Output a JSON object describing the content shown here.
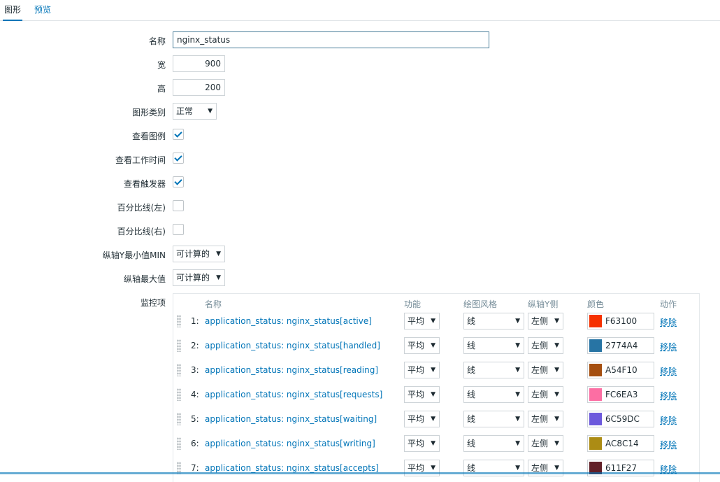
{
  "tabs": [
    {
      "label": "图形",
      "active": true
    },
    {
      "label": "预览",
      "active": false
    }
  ],
  "form": {
    "name_label": "名称",
    "name_value": "nginx_status",
    "width_label": "宽",
    "width_value": "900",
    "height_label": "高",
    "height_value": "200",
    "graph_type_label": "图形类别",
    "graph_type_value": "正常",
    "show_legend_label": "查看图例",
    "show_legend": true,
    "show_worktime_label": "查看工作时间",
    "show_worktime": true,
    "show_triggers_label": "查看触发器",
    "show_triggers": true,
    "percentile_left_label": "百分比线(左)",
    "percentile_left": false,
    "percentile_right_label": "百分比线(右)",
    "percentile_right": false,
    "ymin_label": "纵轴Y最小值MIN",
    "ymin_value": "可计算的",
    "ymax_label": "纵轴最大值",
    "ymax_value": "可计算的",
    "items_label": "监控项"
  },
  "items_table": {
    "headers": {
      "name": "名称",
      "function": "功能",
      "draw_style": "绘图风格",
      "y_axis": "纵轴Y侧",
      "color": "颜色",
      "action": "动作"
    },
    "rows": [
      {
        "num": "1:",
        "name": "application_status: nginx_status[active]",
        "function": "平均",
        "draw_style": "线",
        "y_axis": "左侧",
        "color": "F63100",
        "hex": "#F63100",
        "action": "移除"
      },
      {
        "num": "2:",
        "name": "application_status: nginx_status[handled]",
        "function": "平均",
        "draw_style": "线",
        "y_axis": "左侧",
        "color": "2774A4",
        "hex": "#2774A4",
        "action": "移除"
      },
      {
        "num": "3:",
        "name": "application_status: nginx_status[reading]",
        "function": "平均",
        "draw_style": "线",
        "y_axis": "左侧",
        "color": "A54F10",
        "hex": "#A54F10",
        "action": "移除"
      },
      {
        "num": "4:",
        "name": "application_status: nginx_status[requests]",
        "function": "平均",
        "draw_style": "线",
        "y_axis": "左侧",
        "color": "FC6EA3",
        "hex": "#FC6EA3",
        "action": "移除"
      },
      {
        "num": "5:",
        "name": "application_status: nginx_status[waiting]",
        "function": "平均",
        "draw_style": "线",
        "y_axis": "左侧",
        "color": "6C59DC",
        "hex": "#6C59DC",
        "action": "移除"
      },
      {
        "num": "6:",
        "name": "application_status: nginx_status[writing]",
        "function": "平均",
        "draw_style": "线",
        "y_axis": "左侧",
        "color": "AC8C14",
        "hex": "#AC8C14",
        "action": "移除"
      },
      {
        "num": "7:",
        "name": "application_status: nginx_status[accepts]",
        "function": "平均",
        "draw_style": "线",
        "y_axis": "左侧",
        "color": "611F27",
        "hex": "#611F27",
        "action": "移除"
      }
    ]
  },
  "colors": {
    "accent": "#0275b8",
    "text": "#1f2c33",
    "muted": "#768d99",
    "border": "#ced4d8"
  }
}
